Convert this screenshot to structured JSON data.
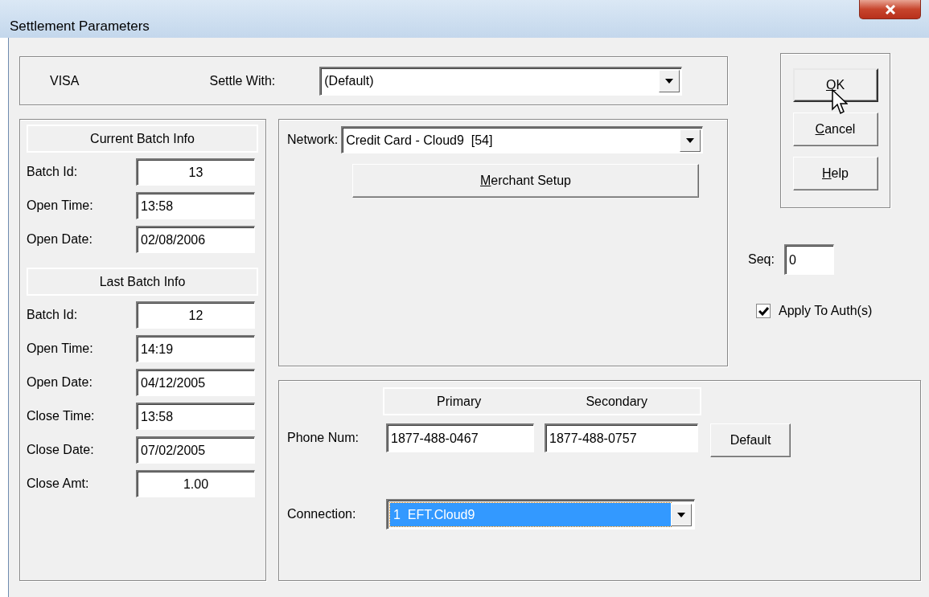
{
  "window": {
    "title": "Settlement Parameters"
  },
  "card_type": "VISA",
  "settle_with": {
    "label": "Settle With:",
    "value": "(Default)"
  },
  "current_batch": {
    "title": "Current Batch Info",
    "fields": [
      {
        "label": "Batch Id:",
        "value": "13",
        "centered": true
      },
      {
        "label": "Open Time:",
        "value": "13:58",
        "centered": false
      },
      {
        "label": "Open Date:",
        "value": "02/08/2006",
        "centered": false
      }
    ]
  },
  "last_batch": {
    "title": "Last Batch Info",
    "fields": [
      {
        "label": "Batch Id:",
        "value": "12",
        "centered": true
      },
      {
        "label": "Open Time:",
        "value": "14:19",
        "centered": false
      },
      {
        "label": "Open Date:",
        "value": "04/12/2005",
        "centered": false
      },
      {
        "label": "Close Time:",
        "value": "13:58",
        "centered": false
      },
      {
        "label": "Close Date:",
        "value": "07/02/2005",
        "centered": false
      },
      {
        "label": "Close Amt:",
        "value": "1.00",
        "centered": true
      }
    ]
  },
  "network": {
    "label": "Network:",
    "value": "Credit Card - Cloud9  [54]"
  },
  "merchant_button": {
    "label": "Merchant Setup"
  },
  "phone": {
    "columns": [
      "Primary",
      "Secondary"
    ],
    "label": "Phone Num:",
    "values": [
      "1877-488-0467",
      "1877-488-0757"
    ]
  },
  "default_button": {
    "label": "Default"
  },
  "connection": {
    "label": "Connection:",
    "value": "1  EFT.Cloud9",
    "focused": true
  },
  "buttons": [
    {
      "label": "OK",
      "default": true
    },
    {
      "label": "Cancel",
      "default": false
    },
    {
      "label": "Help",
      "default": false
    }
  ],
  "seq": {
    "label": "Seq:",
    "value": "0"
  },
  "apply_to_auths": {
    "label": "Apply To Auth(s)",
    "checked": true
  }
}
